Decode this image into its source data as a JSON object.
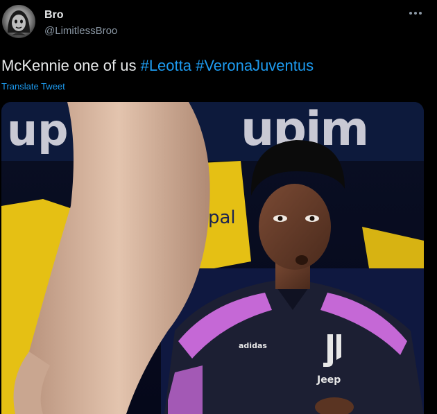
{
  "author": {
    "display_name": "Bro",
    "handle": "@LimitlessBroo",
    "avatar_icon": "avatar-cartoon-face"
  },
  "more_icon": "more-horizontal-icon",
  "tweet": {
    "text_plain": "McKennie one of us ",
    "hashtags": [
      "#Leotta",
      "#VeronaJuventus"
    ]
  },
  "translate_label": "Translate Tweet",
  "media": {
    "board_text": "upim",
    "board_text_left": "up",
    "bench_text": "pal",
    "shirt_brand": "adidas",
    "shirt_sponsor": "Jeep",
    "colors": {
      "board": "#0d1a3c",
      "seat_yellow": "#e5c014",
      "jersey_dark": "#1c1f33",
      "jersey_pink": "#c568d6",
      "leggings": "#d8b59e"
    }
  },
  "colors": {
    "background": "#000000",
    "accent": "#1d9bf0",
    "text_primary": "#e7e9ea",
    "text_secondary": "#8b98a5"
  }
}
